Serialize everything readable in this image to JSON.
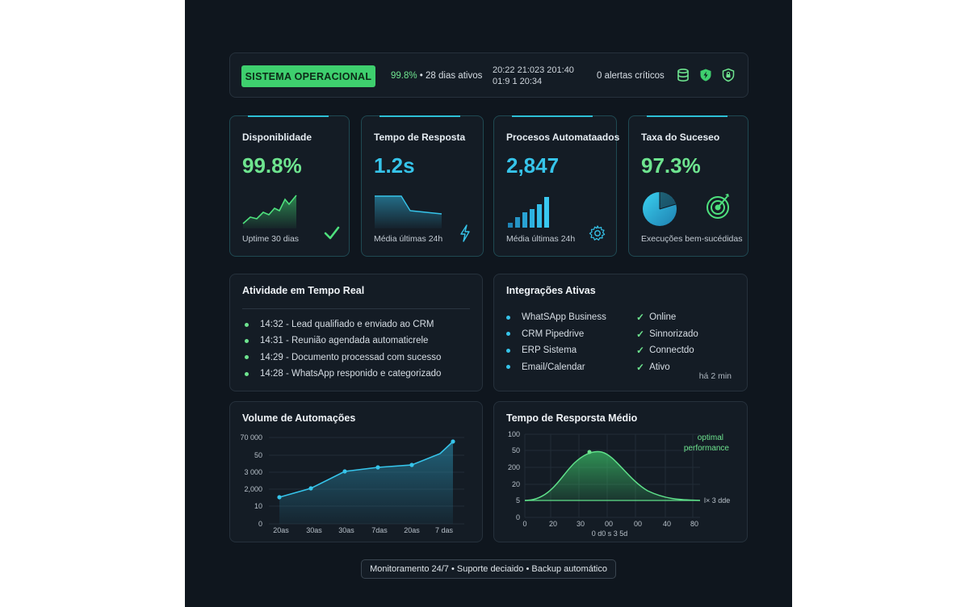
{
  "status_bar": {
    "badge": "SISTEMA OPERACIONAL",
    "uptime_value": "99.8%",
    "uptime_rest": " • 28 dias ativos",
    "clock_line1": "20:22 21:023 201:40",
    "clock_line2": "01:9 1 20:34",
    "alerts": "0 alertas críticos",
    "icons": [
      "database-icon",
      "shield-bolt-icon",
      "shield-lock-icon"
    ]
  },
  "kpis": [
    {
      "title": "Disponiblidade",
      "value": "99.8%",
      "caption": "Uptime 30 dias",
      "color": "#6ee48f",
      "icon": "checkmark-icon"
    },
    {
      "title": "Tempo de Resposta",
      "value": "1.2s",
      "caption": "Média últimas 24h",
      "color": "#36c4ea",
      "icon": "lightning-icon"
    },
    {
      "title": "Procesos Automataados",
      "value": "2,847",
      "caption": "Média últimas 24h",
      "color": "#36c4ea",
      "icon": "gear-icon"
    },
    {
      "title": "Taxa do Suceseo",
      "value": "97.3%",
      "caption": "Execuções bem-sucédidas",
      "color": "#6ee48f",
      "icon": "target-icon"
    }
  ],
  "activity": {
    "title": "Atividade em Tempo Real",
    "items": [
      "14:32 - Lead qualifiado e enviado ao CRM",
      "14:31 - Reunião agendada automaticrele",
      "14:29 - Documento processad com sucesso",
      "14:28 - WhatsApp responido e categorizado"
    ]
  },
  "integrations": {
    "title": "Integrações Ativas",
    "names": [
      "WhatSApp Business",
      "CRM Pipedrive",
      "ERP Sistema",
      "Email/Calendar"
    ],
    "statuses": [
      "Online",
      "Sinnorizado",
      "Connectdo",
      "Ativo"
    ],
    "updated": "há 2 min"
  },
  "volume_chart": {
    "title": "Volume de Automações",
    "y_ticks": [
      "70 000",
      "50",
      "3 000",
      "2,000",
      "10",
      "0"
    ],
    "x_ticks": [
      "20as",
      "30as",
      "30as",
      "7das",
      "20as",
      "7 das"
    ]
  },
  "response_chart": {
    "title": "Tempo de Resporsta Médio",
    "y_ticks": [
      "100",
      "50",
      "200",
      "20",
      "5",
      "0"
    ],
    "x_ticks": [
      "0",
      "20",
      "30",
      "00",
      "00",
      "40",
      "80"
    ],
    "x_label": "0 d0 s 3 5d",
    "annotation_line1": "optimal",
    "annotation_line2": "performance",
    "baseline_label": "l× 3 dde"
  },
  "footer": "Monitoramento 24/7 • Suporte deciaido • Backup automático",
  "colors": {
    "accent_green": "#6ee48f",
    "accent_blue": "#36c4ea",
    "background": "#0f161e",
    "panel": "#141c25"
  }
}
